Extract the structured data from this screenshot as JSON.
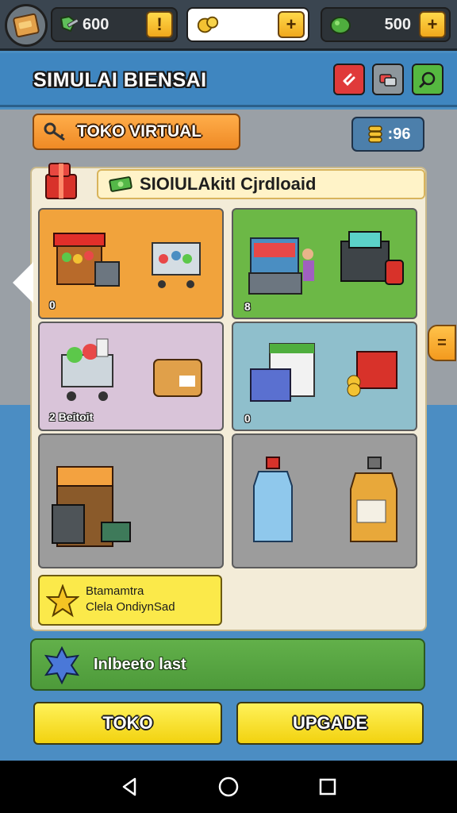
{
  "topbar": {
    "resources": [
      {
        "name": "gems",
        "value": "600",
        "icon": "wrench-gem-icon",
        "plus": "!"
      },
      {
        "name": "energy",
        "value": "",
        "icon": "gold-coins-icon",
        "plus": "+"
      },
      {
        "name": "cash",
        "value": "500",
        "icon": "green-money-icon",
        "plus": "+"
      }
    ]
  },
  "header": {
    "title": "SIMULAI BIENSAI",
    "buttons": [
      "exit-icon",
      "cards-icon",
      "search-icon"
    ]
  },
  "store": {
    "label": "TOKO VIRTUAL",
    "timer_value": ":96"
  },
  "panel": {
    "tab_label": "SIOlULAkitl Cjrdloaid",
    "tiles": [
      {
        "label": "0",
        "color": "#f1a33c"
      },
      {
        "label": "8",
        "color": "#6cb846"
      },
      {
        "label": "2  Beitoit",
        "color": "#d9c4d9"
      },
      {
        "label": "0",
        "color": "#8fbfcc"
      },
      {
        "label": "",
        "color": "#9c9c9c"
      },
      {
        "label": "",
        "color": "#9c9c9c"
      }
    ]
  },
  "side_button": "=",
  "quest": {
    "line1": "Btamamtra",
    "line2": "Clela OndiynSad"
  },
  "banner": {
    "text": "Inlbeeto last"
  },
  "actions": {
    "left": "TOKO",
    "right": "UPGADE"
  },
  "colors": {
    "accent_orange": "#ef8a25",
    "accent_yellow": "#f2d20f",
    "accent_green": "#4d9a3a",
    "sky_blue": "#4b8dc3"
  }
}
